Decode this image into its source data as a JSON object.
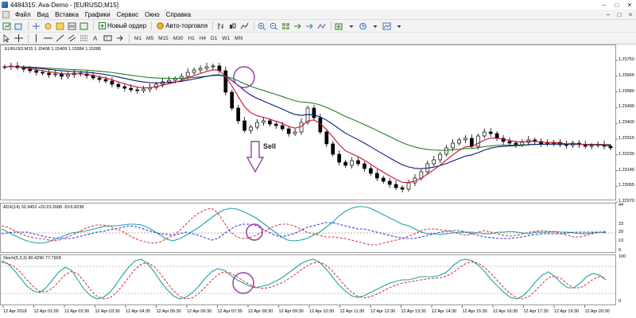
{
  "window": {
    "title": "4484315: Ava-Demo - [EURUSD,M15]",
    "controls": [
      "–",
      "□",
      "✕"
    ]
  },
  "menu": {
    "items": [
      "Файл",
      "Вид",
      "Вставка",
      "Графики",
      "Сервис",
      "Окно",
      "Справка"
    ],
    "right_controls": [
      "–",
      "□",
      "×"
    ]
  },
  "toolbar": {
    "new_order_label": "Новый ордер",
    "auto_trading_label": "Авто-торговля",
    "timeframes": [
      "M1",
      "M5",
      "M15",
      "M30",
      "H1",
      "H4",
      "D1",
      "W1",
      "MN"
    ]
  },
  "chart": {
    "symbol_header": "EURUSD,M15  1.15408 1.15409 1.15384 1.15386",
    "annotation_text": "Sell",
    "price_ticks": [
      "1.23750",
      "1.23665",
      "1.23580",
      "1.23490",
      "1.23400",
      "1.23315",
      "1.23230",
      "1.23140",
      "1.23055",
      "1.22970"
    ],
    "adx_header": "ADX(14) 32.9452 +DI:23.2688 -DI:6.8238",
    "adx_ticks": [
      "44",
      "23",
      "20",
      "13",
      "0"
    ],
    "stoch_header": "Stoch(5,3,3) 80.4290 77.7928",
    "stoch_ticks": [
      "100",
      "0"
    ],
    "time_ticks": [
      "12 Apr 2018",
      "12 Apr 01:00",
      "12 Apr 02:30",
      "12 Apr 03:30",
      "12 Apr 04:30",
      "12 Apr 05:30",
      "12 Apr 06:30",
      "12 Apr 07:30",
      "12 Apr 08:30",
      "12 Apr 09:30",
      "12 Apr 10:30",
      "12 Apr 11:30",
      "12 Apr 12:30",
      "12 Apr 13:30",
      "12 Apr 14:30",
      "12 Apr 15:30",
      "12 Apr 16:30",
      "12 Apr 17:30",
      "12 Apr 19:30",
      "12 Apr 20:30"
    ],
    "colors": {
      "ema_fast": "#c8102e",
      "ema_mid": "#0b1a7a",
      "ema_slow": "#1e7f1e",
      "adx": "#1fa3a8",
      "plus_di": "#d93a3a",
      "minus_di": "#3a3ad9",
      "stoch_main": "#1fa3a8",
      "stoch_signal": "#d93a3a",
      "annotation": "#9b3fa8"
    }
  }
}
